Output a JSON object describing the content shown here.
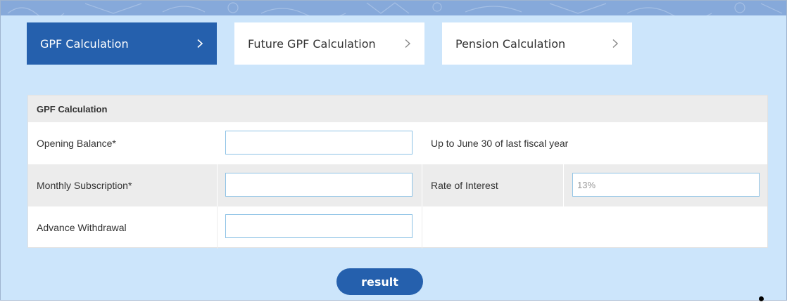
{
  "tabs": [
    {
      "label": "GPF Calculation",
      "active": true
    },
    {
      "label": "Future GPF Calculation",
      "active": false
    },
    {
      "label": "Pension Calculation",
      "active": false
    }
  ],
  "panel": {
    "title": "GPF Calculation",
    "fields": {
      "opening_balance": {
        "label": "Opening Balance*",
        "value": "",
        "note": "Up to June 30 of last fiscal year"
      },
      "monthly_subscription": {
        "label": "Monthly Subscription*",
        "value": ""
      },
      "rate_of_interest": {
        "label": "Rate of Interest",
        "placeholder": "13%"
      },
      "advance_withdrawal": {
        "label": "Advance Withdrawal",
        "value": ""
      }
    }
  },
  "actions": {
    "result_label": "result"
  },
  "colors": {
    "accent": "#2560ad",
    "page_background": "#cce5fb",
    "banner": "#86a9da",
    "input_border": "#8ec3e6"
  }
}
